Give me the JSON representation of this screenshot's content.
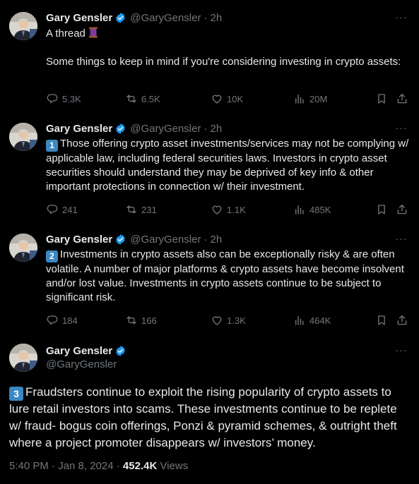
{
  "author": {
    "name": "Gary Gensler",
    "handle": "@GaryGensler",
    "verified_color": "#1d9bf0"
  },
  "tweets": [
    {
      "time": "2h",
      "lines": [
        "A thread",
        "Some things to keep in mind if you're considering investing in crypto assets:"
      ],
      "emoji": "spool-of-thread-icon",
      "stats": {
        "replies": "5.3K",
        "reposts": "6.5K",
        "likes": "10K",
        "views": "20M"
      }
    },
    {
      "time": "2h",
      "number": "1",
      "body": "Those offering crypto asset investments/services may not be complying w/ applicable law, including federal securities laws. Investors in crypto asset securities should understand they may be deprived of key info & other important protections in connection w/ their investment.",
      "stats": {
        "replies": "241",
        "reposts": "231",
        "likes": "1.1K",
        "views": "485K"
      }
    },
    {
      "time": "2h",
      "number": "2",
      "body": "Investments in crypto assets also can be exceptionally risky & are often volatile. A number of major platforms & crypto assets have become insolvent and/or lost value. Investments in crypto assets continue to be subject to significant risk.",
      "stats": {
        "replies": "184",
        "reposts": "166",
        "likes": "1.3K",
        "views": "464K"
      }
    },
    {
      "number": "3",
      "body": "Fraudsters continue to exploit the rising popularity of crypto assets to lure retail investors into scams. These investments continue to be replete w/ fraud- bogus coin offerings, Ponzi & pyramid schemes, & outright theft where a project promoter disappears w/ investors’ money.",
      "timestamp": "5:40 PM · Jan 8, 2024 · ",
      "views_count": "452.4K",
      "views_label": " Views"
    }
  ],
  "separator": "·",
  "more_glyph": "···"
}
